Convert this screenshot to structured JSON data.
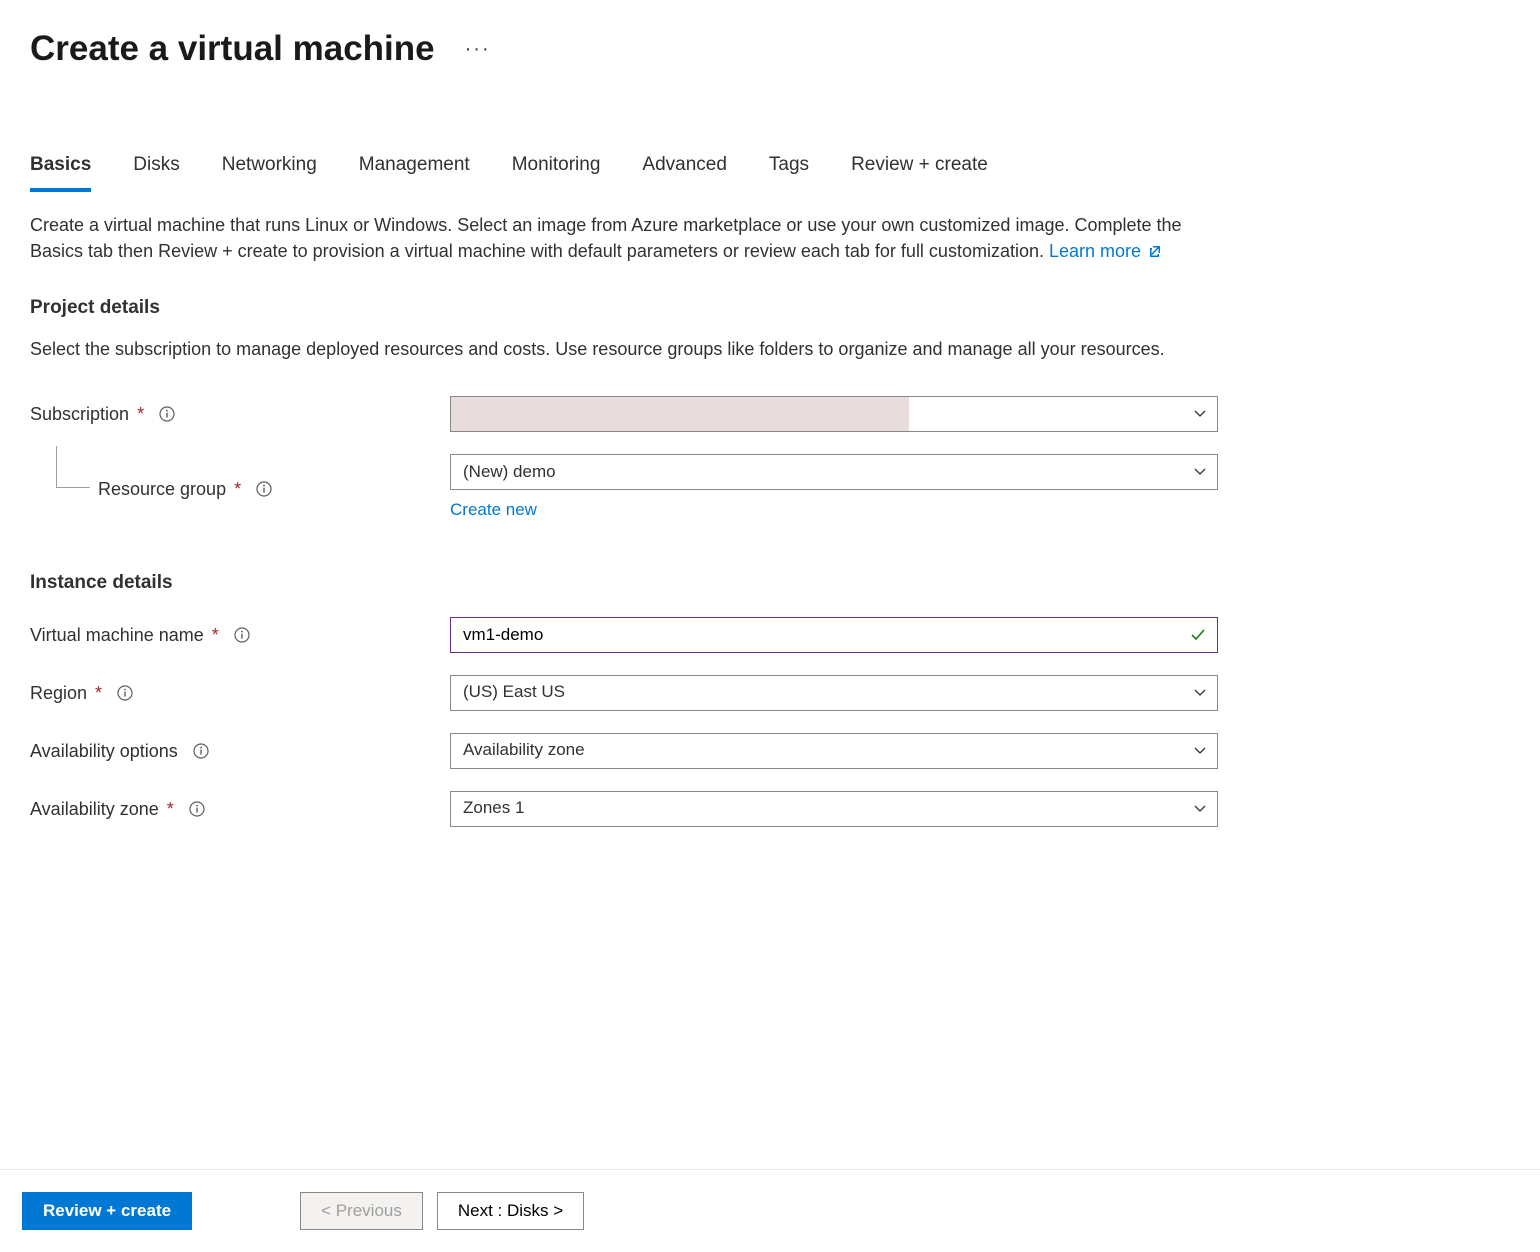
{
  "header": {
    "title": "Create a virtual machine"
  },
  "tabs": [
    "Basics",
    "Disks",
    "Networking",
    "Management",
    "Monitoring",
    "Advanced",
    "Tags",
    "Review + create"
  ],
  "active_tab": "Basics",
  "intro": {
    "text": "Create a virtual machine that runs Linux or Windows. Select an image from Azure marketplace or use your own customized image. Complete the Basics tab then Review + create to provision a virtual machine with default parameters or review each tab for full customization. ",
    "learn_more": "Learn more"
  },
  "sections": {
    "project": {
      "heading": "Project details",
      "desc": "Select the subscription to manage deployed resources and costs. Use resource groups like folders to organize and manage all your resources.",
      "subscription_label": "Subscription",
      "subscription_value": "",
      "resource_group_label": "Resource group",
      "resource_group_value": "(New) demo",
      "create_new": "Create new"
    },
    "instance": {
      "heading": "Instance details",
      "vm_name_label": "Virtual machine name",
      "vm_name_value": "vm1-demo",
      "region_label": "Region",
      "region_value": "(US) East US",
      "avail_options_label": "Availability options",
      "avail_options_value": "Availability zone",
      "avail_zone_label": "Availability zone",
      "avail_zone_value": "Zones 1"
    }
  },
  "footer": {
    "review_create": "Review + create",
    "previous": "< Previous",
    "next": "Next : Disks >"
  }
}
